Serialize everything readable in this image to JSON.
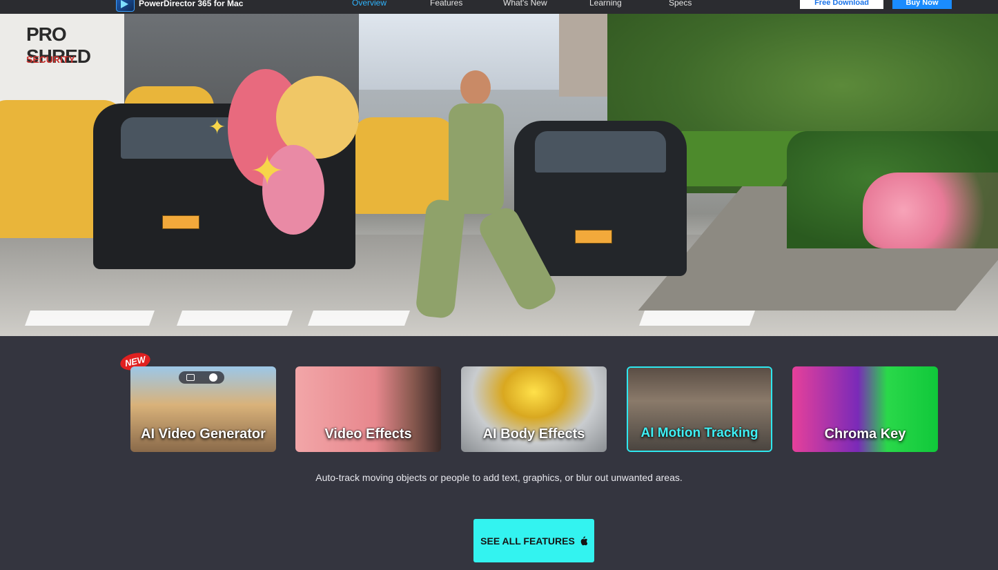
{
  "nav": {
    "brand": "PowerDirector 365 for Mac",
    "links": [
      {
        "label": "Overview",
        "active": true
      },
      {
        "label": "Features",
        "active": false
      },
      {
        "label": "What's New",
        "active": false
      },
      {
        "label": "Learning",
        "active": false
      },
      {
        "label": "Specs",
        "active": false
      }
    ],
    "free_download": "Free Download",
    "buy_now": "Buy Now"
  },
  "hero": {
    "sign_line1": "PRO SHRED",
    "sign_line2": "SECURITY"
  },
  "features": {
    "new_badge": "NEW",
    "cards": [
      {
        "title": "AI Video Generator",
        "selected": false
      },
      {
        "title": "Video Effects",
        "selected": false
      },
      {
        "title": "AI Body Effects",
        "selected": false
      },
      {
        "title": "AI Motion Tracking",
        "selected": true
      },
      {
        "title": "Chroma Key",
        "selected": false
      }
    ],
    "description": "Auto-track moving objects or people to add text, graphics, or blur out unwanted areas.",
    "cta_label": "SEE ALL FEATURES",
    "cta_icon": "apple-icon"
  },
  "colors": {
    "nav_bg": "#2b2c30",
    "page_bg": "#34353f",
    "active_link": "#2fb5ff",
    "cta_bg": "#33f3f0",
    "selected_border": "#2ee8f0",
    "buy_now_bg": "#1a8cff"
  }
}
